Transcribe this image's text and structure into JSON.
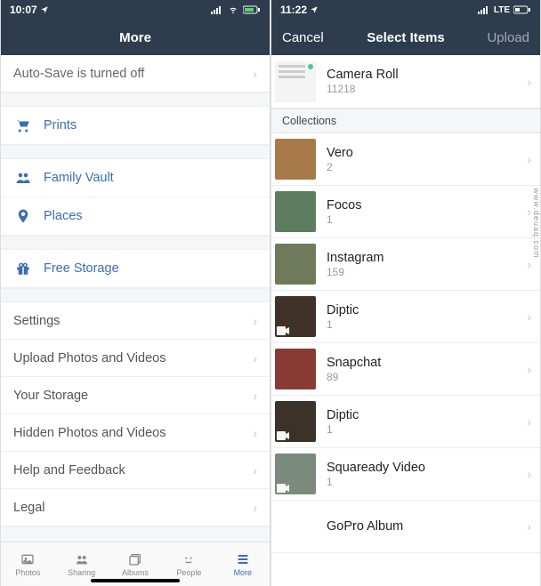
{
  "watermark": "www.deuaq.com",
  "left": {
    "status": {
      "time": "10:07",
      "location_icon": true,
      "carrier": "",
      "network": "wifi",
      "battery_icon": true
    },
    "nav": {
      "title": "More"
    },
    "banner": {
      "text": "Auto-Save is turned off"
    },
    "group1": [
      {
        "icon": "cart-icon",
        "label": "Prints"
      }
    ],
    "group2": [
      {
        "icon": "people-icon",
        "label": "Family Vault"
      },
      {
        "icon": "pin-icon",
        "label": "Places"
      }
    ],
    "group3": [
      {
        "icon": "gift-icon",
        "label": "Free Storage"
      }
    ],
    "group4": [
      {
        "label": "Settings"
      },
      {
        "label": "Upload Photos and Videos"
      },
      {
        "label": "Your Storage"
      },
      {
        "label": "Hidden Photos and Videos"
      },
      {
        "label": "Help and Feedback"
      },
      {
        "label": "Legal"
      }
    ],
    "tabs": [
      {
        "label": "Photos"
      },
      {
        "label": "Sharing"
      },
      {
        "label": "Albums"
      },
      {
        "label": "People"
      },
      {
        "label": "More",
        "active": true
      }
    ]
  },
  "right": {
    "status": {
      "time": "11:22",
      "location_icon": true,
      "carrier": "LTE",
      "battery_icon": true
    },
    "nav": {
      "left": "Cancel",
      "title": "Select Items",
      "right": "Upload"
    },
    "top_album": {
      "title": "Camera Roll",
      "count": "11218"
    },
    "collections_header": "Collections",
    "albums": [
      {
        "title": "Vero",
        "count": "2",
        "color": "#a87a4a"
      },
      {
        "title": "Focos",
        "count": "1",
        "color": "#5d7e5e"
      },
      {
        "title": "Instagram",
        "count": "159",
        "color": "#6f7a5a"
      },
      {
        "title": "Diptic",
        "count": "1",
        "color": "#403228",
        "video": true
      },
      {
        "title": "Snapchat",
        "count": "89",
        "color": "#8a3a34"
      },
      {
        "title": "Diptic",
        "count": "1",
        "color": "#3b332a",
        "video": true
      },
      {
        "title": "Squaready Video",
        "count": "1",
        "color": "#7a8a7c",
        "video": true
      },
      {
        "title": "GoPro Album",
        "count": "",
        "color": "#ffffff"
      }
    ]
  }
}
